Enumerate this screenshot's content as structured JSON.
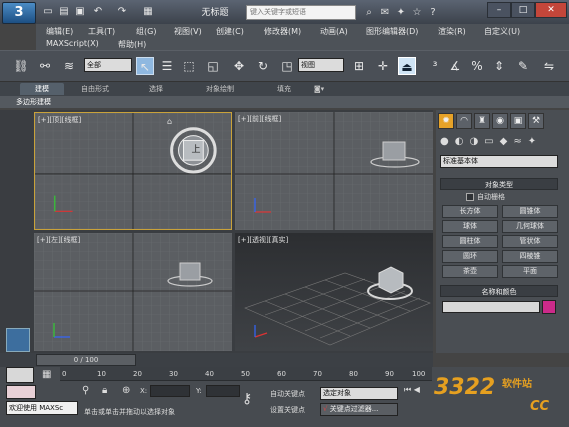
{
  "app_button": {
    "label": "3"
  },
  "title": "无标题",
  "search": {
    "placeholder": "键入关键字或短语"
  },
  "menu": [
    "编辑(E)",
    "工具(T)",
    "组(G)",
    "视图(V)",
    "创建(C)",
    "修改器(M)",
    "动画(A)",
    "图形编辑器(D)",
    "渲染(R)",
    "自定义(U)",
    "MAXScript(X)",
    "帮助(H)"
  ],
  "toolbar": {
    "selection_filter": "全部",
    "ref_coord": "视图"
  },
  "ribbon": {
    "tabs": [
      "建模",
      "自由形式",
      "选择",
      "对象绘制",
      "填充"
    ],
    "sub_label": "多边形建模"
  },
  "viewports": {
    "top": "[+][顶][线框]",
    "front": "[+][前][线框]",
    "left": "[+][左][线框]",
    "persp": "[+][透视][真实]"
  },
  "viewcube": {
    "top_face": "上"
  },
  "command_panel": {
    "dropdown": "标准基本体",
    "object_type_title": "对象类型",
    "autogrid": "自动栅格",
    "buttons": [
      "长方体",
      "圆锥体",
      "球体",
      "几何球体",
      "圆柱体",
      "管状体",
      "圆环",
      "四棱锥",
      "茶壶",
      "平面"
    ],
    "name_color_title": "名称和颜色"
  },
  "timeline": {
    "frame": "0 / 100",
    "ticks": [
      "0",
      "10",
      "20",
      "30",
      "40",
      "50",
      "60",
      "70",
      "80",
      "90",
      "100"
    ]
  },
  "status": {
    "welcome": "欢迎使用 MAXSc",
    "prompt": "单击或单击并拖动以选择对象",
    "x_label": "X:",
    "y_label": "Y:",
    "auto_key": "自动关键点",
    "set_key": "设置关键点",
    "selected": "选定对象",
    "key_filters": "关键点过滤器..."
  },
  "watermark": {
    "brand": "3322",
    "suffix": "软件站",
    "domain": "CC"
  },
  "colors": {
    "accent": "#d4237a",
    "viewport_active": "#c9a23a",
    "swatch": "#cc2a8a"
  }
}
